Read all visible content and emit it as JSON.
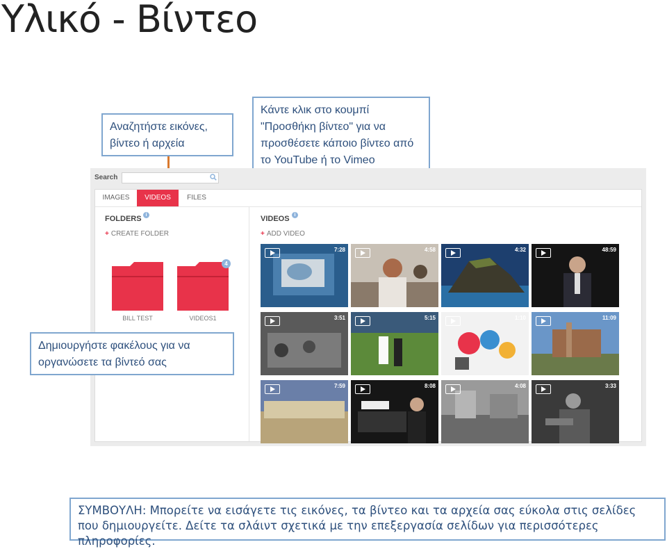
{
  "slide": {
    "title": "Υλικό - Βίντεο"
  },
  "callouts": {
    "search": "Αναζητήστε εικόνες, βίντεο ή αρχεία",
    "add_video": "Κάντε κλικ στο κουμπί \"Προσθήκη βίντεο\" για να προσθέσετε κάποιο βίντεο από το YouTube ή το Vimeo",
    "folders": "Δημιουργήστε φακέλους για να οργανώσετε τα βίντεό σας"
  },
  "app": {
    "search_label": "Search",
    "tabs": [
      {
        "label": "IMAGES",
        "active": false
      },
      {
        "label": "VIDEOS",
        "active": true
      },
      {
        "label": "FILES",
        "active": false
      }
    ],
    "folders": {
      "title": "FOLDERS",
      "create_label": "CREATE FOLDER",
      "items": [
        {
          "name": "BILL TEST",
          "badge": ""
        },
        {
          "name": "VIDEOS1",
          "badge": "4"
        }
      ]
    },
    "videos": {
      "title": "VIDEOS",
      "add_label": "ADD VIDEO",
      "items": [
        {
          "duration": "7:28"
        },
        {
          "duration": "4:58"
        },
        {
          "duration": "4:32"
        },
        {
          "duration": "48:59"
        },
        {
          "duration": "3:51"
        },
        {
          "duration": "5:15"
        },
        {
          "duration": "1:10"
        },
        {
          "duration": "11:09"
        },
        {
          "duration": "7:59"
        },
        {
          "duration": "8:08"
        },
        {
          "duration": "4:08"
        },
        {
          "duration": "3:33"
        }
      ]
    },
    "colors": {
      "accent": "#e8334a",
      "info": "#8fb4dc",
      "callout_border": "#7fa6cf",
      "connector": "#d9792e"
    }
  },
  "tip": "ΣΥΜΒΟΥΛΗ: Μπορείτε να εισάγετε τις εικόνες, τα βίντεο και τα αρχεία σας εύκολα στις σελίδες που δημιουργείτε. Δείτε τα σλάιντ σχετικά με την επεξεργασία σελίδων για περισσότερες πληροφορίες."
}
